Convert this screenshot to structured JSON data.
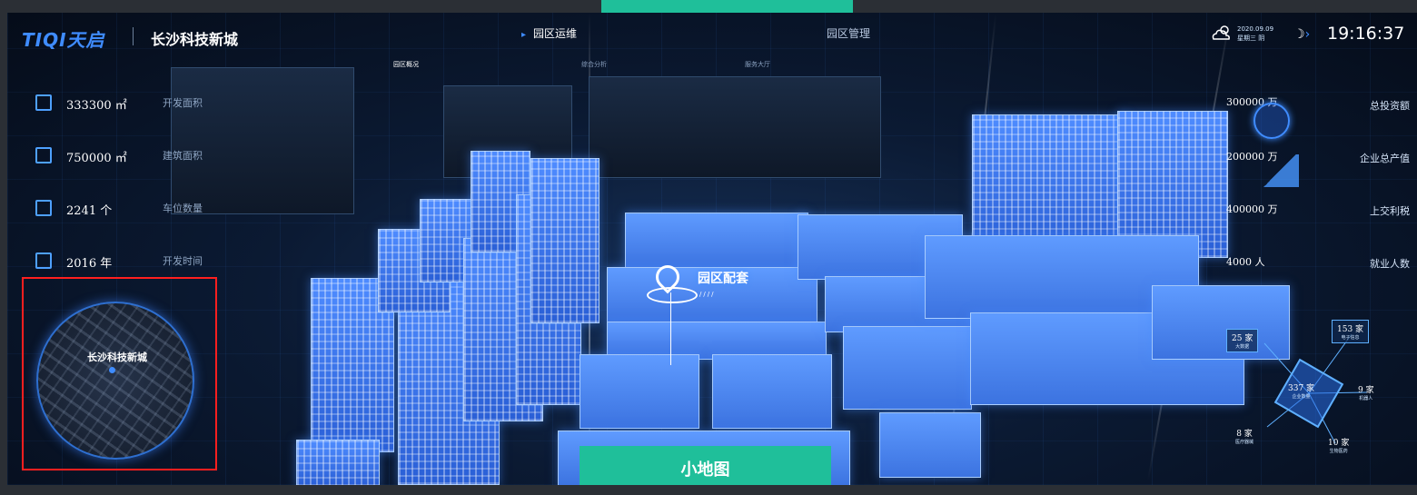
{
  "header": {
    "logo": "TIQI天启",
    "city": "长沙科技新城",
    "nav": [
      "园区运维",
      "园区管理"
    ],
    "subnav": [
      "园区概况",
      "综合分析",
      "服务大厅"
    ],
    "date_line1": "2020.09.09",
    "date_line2": "星期三  阴",
    "time": "19:16:37"
  },
  "left_stats": [
    {
      "value": "333300 ㎡",
      "label": "开发面积",
      "icon": "area-icon"
    },
    {
      "value": "750000 ㎡",
      "label": "建筑面积",
      "icon": "building-area-icon"
    },
    {
      "value": "2241 个",
      "label": "车位数量",
      "icon": "parking-icon"
    },
    {
      "value": "2016 年",
      "label": "开发时间",
      "icon": "clock-icon"
    }
  ],
  "minimap": {
    "label": "长沙科技新城"
  },
  "map_pin": {
    "label": "园区配套"
  },
  "right_stats": [
    {
      "value": "300000 万",
      "label": "总投资额"
    },
    {
      "value": "200000 万",
      "label": "企业总产值"
    },
    {
      "value": "400000 万",
      "label": "上交利税"
    },
    {
      "value": "4000 人",
      "label": "就业人数"
    }
  ],
  "enterprise": {
    "center": {
      "value": "337 家",
      "label": "企业数量"
    },
    "nodes": [
      {
        "value": "25 家",
        "label": "大数据"
      },
      {
        "value": "153 家",
        "label": "电子信息"
      },
      {
        "value": "9 家",
        "label": "机器人"
      },
      {
        "value": "8 家",
        "label": "医疗器械"
      },
      {
        "value": "10 家",
        "label": "生物医药"
      }
    ]
  },
  "caption": "小地图",
  "colors": {
    "accent": "#1fbf9a",
    "highlight": "#ff1f1f",
    "primary": "#3f8cff"
  }
}
